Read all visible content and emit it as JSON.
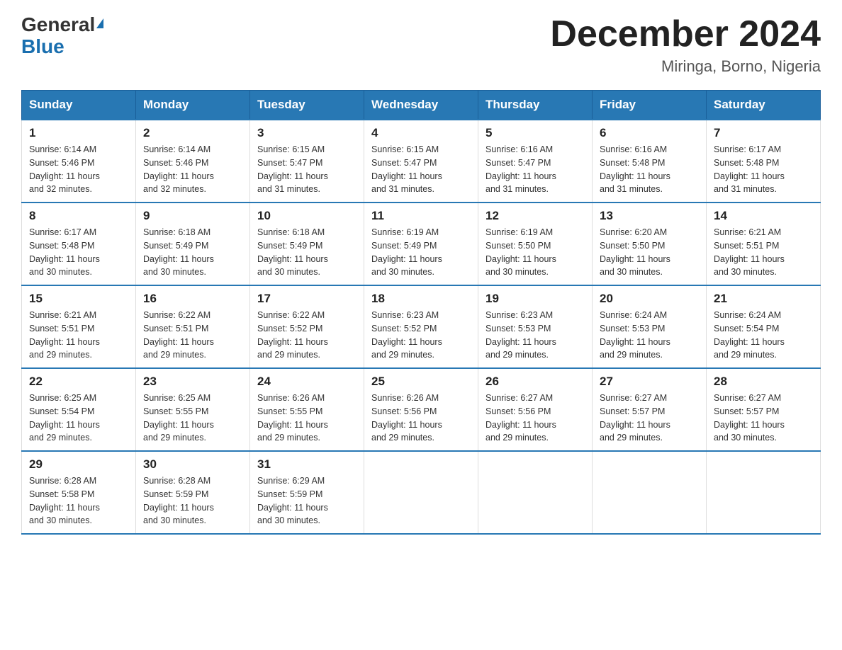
{
  "header": {
    "logo_general": "General",
    "logo_blue": "Blue",
    "month_title": "December 2024",
    "location": "Miringa, Borno, Nigeria"
  },
  "weekdays": [
    "Sunday",
    "Monday",
    "Tuesday",
    "Wednesday",
    "Thursday",
    "Friday",
    "Saturday"
  ],
  "weeks": [
    [
      {
        "day": "1",
        "sunrise": "6:14 AM",
        "sunset": "5:46 PM",
        "daylight": "11 hours and 32 minutes."
      },
      {
        "day": "2",
        "sunrise": "6:14 AM",
        "sunset": "5:46 PM",
        "daylight": "11 hours and 32 minutes."
      },
      {
        "day": "3",
        "sunrise": "6:15 AM",
        "sunset": "5:47 PM",
        "daylight": "11 hours and 31 minutes."
      },
      {
        "day": "4",
        "sunrise": "6:15 AM",
        "sunset": "5:47 PM",
        "daylight": "11 hours and 31 minutes."
      },
      {
        "day": "5",
        "sunrise": "6:16 AM",
        "sunset": "5:47 PM",
        "daylight": "11 hours and 31 minutes."
      },
      {
        "day": "6",
        "sunrise": "6:16 AM",
        "sunset": "5:48 PM",
        "daylight": "11 hours and 31 minutes."
      },
      {
        "day": "7",
        "sunrise": "6:17 AM",
        "sunset": "5:48 PM",
        "daylight": "11 hours and 31 minutes."
      }
    ],
    [
      {
        "day": "8",
        "sunrise": "6:17 AM",
        "sunset": "5:48 PM",
        "daylight": "11 hours and 30 minutes."
      },
      {
        "day": "9",
        "sunrise": "6:18 AM",
        "sunset": "5:49 PM",
        "daylight": "11 hours and 30 minutes."
      },
      {
        "day": "10",
        "sunrise": "6:18 AM",
        "sunset": "5:49 PM",
        "daylight": "11 hours and 30 minutes."
      },
      {
        "day": "11",
        "sunrise": "6:19 AM",
        "sunset": "5:49 PM",
        "daylight": "11 hours and 30 minutes."
      },
      {
        "day": "12",
        "sunrise": "6:19 AM",
        "sunset": "5:50 PM",
        "daylight": "11 hours and 30 minutes."
      },
      {
        "day": "13",
        "sunrise": "6:20 AM",
        "sunset": "5:50 PM",
        "daylight": "11 hours and 30 minutes."
      },
      {
        "day": "14",
        "sunrise": "6:21 AM",
        "sunset": "5:51 PM",
        "daylight": "11 hours and 30 minutes."
      }
    ],
    [
      {
        "day": "15",
        "sunrise": "6:21 AM",
        "sunset": "5:51 PM",
        "daylight": "11 hours and 29 minutes."
      },
      {
        "day": "16",
        "sunrise": "6:22 AM",
        "sunset": "5:51 PM",
        "daylight": "11 hours and 29 minutes."
      },
      {
        "day": "17",
        "sunrise": "6:22 AM",
        "sunset": "5:52 PM",
        "daylight": "11 hours and 29 minutes."
      },
      {
        "day": "18",
        "sunrise": "6:23 AM",
        "sunset": "5:52 PM",
        "daylight": "11 hours and 29 minutes."
      },
      {
        "day": "19",
        "sunrise": "6:23 AM",
        "sunset": "5:53 PM",
        "daylight": "11 hours and 29 minutes."
      },
      {
        "day": "20",
        "sunrise": "6:24 AM",
        "sunset": "5:53 PM",
        "daylight": "11 hours and 29 minutes."
      },
      {
        "day": "21",
        "sunrise": "6:24 AM",
        "sunset": "5:54 PM",
        "daylight": "11 hours and 29 minutes."
      }
    ],
    [
      {
        "day": "22",
        "sunrise": "6:25 AM",
        "sunset": "5:54 PM",
        "daylight": "11 hours and 29 minutes."
      },
      {
        "day": "23",
        "sunrise": "6:25 AM",
        "sunset": "5:55 PM",
        "daylight": "11 hours and 29 minutes."
      },
      {
        "day": "24",
        "sunrise": "6:26 AM",
        "sunset": "5:55 PM",
        "daylight": "11 hours and 29 minutes."
      },
      {
        "day": "25",
        "sunrise": "6:26 AM",
        "sunset": "5:56 PM",
        "daylight": "11 hours and 29 minutes."
      },
      {
        "day": "26",
        "sunrise": "6:27 AM",
        "sunset": "5:56 PM",
        "daylight": "11 hours and 29 minutes."
      },
      {
        "day": "27",
        "sunrise": "6:27 AM",
        "sunset": "5:57 PM",
        "daylight": "11 hours and 29 minutes."
      },
      {
        "day": "28",
        "sunrise": "6:27 AM",
        "sunset": "5:57 PM",
        "daylight": "11 hours and 30 minutes."
      }
    ],
    [
      {
        "day": "29",
        "sunrise": "6:28 AM",
        "sunset": "5:58 PM",
        "daylight": "11 hours and 30 minutes."
      },
      {
        "day": "30",
        "sunrise": "6:28 AM",
        "sunset": "5:59 PM",
        "daylight": "11 hours and 30 minutes."
      },
      {
        "day": "31",
        "sunrise": "6:29 AM",
        "sunset": "5:59 PM",
        "daylight": "11 hours and 30 minutes."
      },
      null,
      null,
      null,
      null
    ]
  ],
  "labels": {
    "sunrise": "Sunrise:",
    "sunset": "Sunset:",
    "daylight": "Daylight:"
  }
}
